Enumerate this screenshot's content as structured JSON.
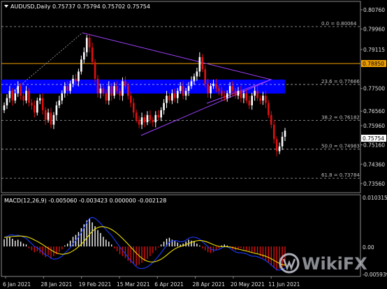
{
  "header": {
    "symbol_tf": "AUDUSD,Daily",
    "ohlc": "0.75737 0.75794 0.75702 0.75754"
  },
  "price_axis": {
    "ticks": [
      "0.80760",
      "0.79960",
      "0.79115",
      "0.77500",
      "0.76560",
      "0.75960",
      "0.75160",
      "0.74360",
      "0.73560"
    ],
    "tag_orange": "0.78850",
    "tag_current": "0.75754"
  },
  "fibonacci": {
    "levels": [
      {
        "label": "0.0 = 0.80064",
        "price": 0.80064
      },
      {
        "label": "23.6 = 0.77666",
        "price": 0.77666
      },
      {
        "label": "38.2 = 0.76182",
        "price": 0.76182
      },
      {
        "label": "50.0 = 0.74983",
        "price": 0.74983
      },
      {
        "label": "61.8 = 0.73784",
        "price": 0.73784
      }
    ]
  },
  "macd": {
    "title": "MACD(12,26,9) -0.005060 -0.003423 0.000000 -0.002128",
    "ticks": [
      "0.010315",
      "0.00",
      "-0.005939"
    ]
  },
  "time_axis": {
    "labels": [
      "6 Jan 2021",
      "28 Jan 2021",
      "19 Feb 2021",
      "15 Mar 2021",
      "6 Apr 2021",
      "28 Apr 2021",
      "20 May 2021",
      "11 Jun 2021"
    ]
  },
  "watermark": "WikiFX",
  "colors": {
    "background": "#000000",
    "bull_candle": "#ffffff",
    "bear_candle": "#e01010",
    "zone": "#0000ff",
    "resistance_line": "#f0a000",
    "triangle": "#a040ff",
    "macd_signal": "#f0e000",
    "macd_line": "#1a3cff"
  },
  "chart_data": {
    "type": "candlestick",
    "closes": [
      0.768,
      0.771,
      0.774,
      0.77,
      0.773,
      0.776,
      0.772,
      0.77,
      0.774,
      0.769,
      0.768,
      0.765,
      0.77,
      0.771,
      0.766,
      0.762,
      0.765,
      0.76,
      0.764,
      0.768,
      0.77,
      0.773,
      0.776,
      0.774,
      0.777,
      0.779,
      0.778,
      0.782,
      0.787,
      0.79,
      0.796,
      0.792,
      0.786,
      0.779,
      0.773,
      0.775,
      0.773,
      0.77,
      0.776,
      0.772,
      0.776,
      0.774,
      0.772,
      0.778,
      0.776,
      0.772,
      0.769,
      0.765,
      0.762,
      0.76,
      0.763,
      0.761,
      0.764,
      0.762,
      0.761,
      0.764,
      0.763,
      0.766,
      0.769,
      0.772,
      0.77,
      0.773,
      0.771,
      0.774,
      0.776,
      0.772,
      0.774,
      0.776,
      0.778,
      0.78,
      0.782,
      0.788,
      0.783,
      0.777,
      0.773,
      0.776,
      0.777,
      0.775,
      0.774,
      0.772,
      0.771,
      0.773,
      0.776,
      0.774,
      0.772,
      0.774,
      0.771,
      0.773,
      0.77,
      0.768,
      0.772,
      0.774,
      0.771,
      0.77,
      0.772,
      0.769,
      0.764,
      0.76,
      0.754,
      0.749,
      0.751,
      0.755,
      0.7575
    ],
    "macd_hist": [
      0.0015,
      0.0018,
      0.002,
      0.0016,
      0.0012,
      0.0014,
      0.001,
      0.0006,
      0.0004,
      -0.0004,
      -0.0008,
      -0.0012,
      -0.001,
      -0.0014,
      -0.0018,
      -0.0022,
      -0.0018,
      -0.0024,
      -0.002,
      -0.0016,
      -0.0012,
      -0.0006,
      0.0002,
      0.0006,
      0.0012,
      0.002,
      0.0024,
      0.003,
      0.0038,
      0.0046,
      0.0054,
      0.0058,
      0.005,
      0.0042,
      0.0034,
      0.0028,
      0.002,
      0.0014,
      0.001,
      0.0004,
      -0.0004,
      -0.001,
      -0.0016,
      -0.002,
      -0.0024,
      -0.003,
      -0.0034,
      -0.0036,
      -0.004,
      -0.0038,
      -0.0034,
      -0.003,
      -0.0026,
      -0.002,
      -0.0014,
      -0.0008,
      -0.0002,
      0.0004,
      0.001,
      0.0016,
      0.0018,
      0.0014,
      0.0012,
      0.0008,
      0.0004,
      0.0006,
      0.001,
      0.0014,
      0.0012,
      0.001,
      0.0006,
      0.0002,
      -0.0004,
      -0.0008,
      -0.0012,
      -0.0014,
      -0.0012,
      -0.0008,
      -0.0004,
      0.0002,
      0.0004,
      0.0002,
      -0.0002,
      -0.0006,
      -0.0008,
      -0.0006,
      -0.0004,
      -0.0006,
      -0.0008,
      -0.0012,
      -0.0014,
      -0.0012,
      -0.0016,
      -0.002,
      -0.0024,
      -0.0028,
      -0.0034,
      -0.004,
      -0.0045,
      -0.005,
      -0.0046,
      -0.0042,
      -0.004
    ],
    "ylim": [
      0.7324,
      0.8105
    ],
    "macd_ylim": [
      -0.00594,
      0.0103
    ]
  }
}
